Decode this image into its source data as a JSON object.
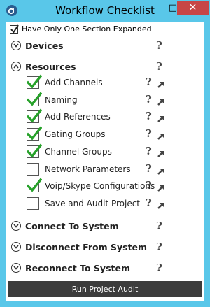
{
  "window": {
    "title": "Workflow Checklist",
    "minimize_glyph": "—",
    "maximize_glyph": "□",
    "close_glyph": "✕"
  },
  "options": {
    "single_expand_label": "Have Only One Section Expanded",
    "single_expand_checked": true
  },
  "help_glyph": "?",
  "sections": {
    "devices": {
      "label": "Devices",
      "expanded": false
    },
    "resources": {
      "label": "Resources",
      "expanded": true,
      "items": [
        {
          "label": "Add Channels",
          "checked": true
        },
        {
          "label": "Naming",
          "checked": true
        },
        {
          "label": "Add References",
          "checked": true
        },
        {
          "label": "Gating Groups",
          "checked": true
        },
        {
          "label": "Channel Groups",
          "checked": true
        },
        {
          "label": "Network Parameters",
          "checked": false
        },
        {
          "label": "Voip/Skype Configurations",
          "checked": true
        },
        {
          "label": "Save and Audit Project",
          "checked": false
        }
      ]
    },
    "connect": {
      "label": "Connect To System",
      "expanded": false
    },
    "disconnect": {
      "label": "Disconnect From System",
      "expanded": false
    },
    "reconnect": {
      "label": "Reconnect To System",
      "expanded": false
    }
  },
  "audit_button": {
    "label": "Run Project Audit"
  },
  "colors": {
    "frame": "#59c7e9",
    "close": "#c74646",
    "check": "#27a12a",
    "button": "#3c3c3c"
  }
}
